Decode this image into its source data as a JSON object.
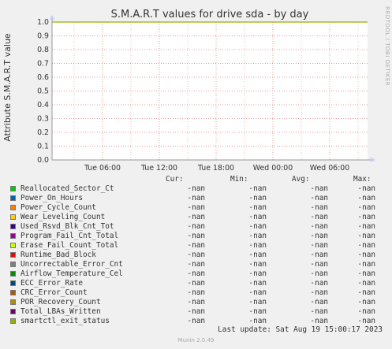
{
  "title": "S.M.A.R.T values for drive sda - by day",
  "watermark": "RRDTOOL / TOBI OETIKER",
  "chart_data": {
    "type": "line",
    "ylabel": "Attribute S.M.A.R.T value",
    "ylim": [
      0.0,
      1.0
    ],
    "yticks": [
      "0.0",
      "0.1",
      "0.2",
      "0.3",
      "0.4",
      "0.5",
      "0.6",
      "0.7",
      "0.8",
      "0.9",
      "1.0"
    ],
    "xticks": [
      "Tue 06:00",
      "Tue 12:00",
      "Tue 18:00",
      "Wed 00:00",
      "Wed 06:00"
    ],
    "grid": true,
    "series": [
      {
        "name": "Reallocated_Sector_Ct",
        "color": "#00cc00",
        "cur": "-nan",
        "min": "-nan",
        "avg": "-nan",
        "max": "-nan"
      },
      {
        "name": "Power_On_Hours",
        "color": "#0066b3",
        "cur": "-nan",
        "min": "-nan",
        "avg": "-nan",
        "max": "-nan"
      },
      {
        "name": "Power_Cycle_Count",
        "color": "#ff8000",
        "cur": "-nan",
        "min": "-nan",
        "avg": "-nan",
        "max": "-nan"
      },
      {
        "name": "Wear_Leveling_Count",
        "color": "#ffcc00",
        "cur": "-nan",
        "min": "-nan",
        "avg": "-nan",
        "max": "-nan"
      },
      {
        "name": "Used_Rsvd_Blk_Cnt_Tot",
        "color": "#330099",
        "cur": "-nan",
        "min": "-nan",
        "avg": "-nan",
        "max": "-nan"
      },
      {
        "name": "Program_Fail_Cnt_Total",
        "color": "#990099",
        "cur": "-nan",
        "min": "-nan",
        "avg": "-nan",
        "max": "-nan"
      },
      {
        "name": "Erase_Fail_Count_Total",
        "color": "#ccff00",
        "cur": "-nan",
        "min": "-nan",
        "avg": "-nan",
        "max": "-nan"
      },
      {
        "name": "Runtime_Bad_Block",
        "color": "#ff0000",
        "cur": "-nan",
        "min": "-nan",
        "avg": "-nan",
        "max": "-nan"
      },
      {
        "name": "Uncorrectable_Error_Cnt",
        "color": "#808080",
        "cur": "-nan",
        "min": "-nan",
        "avg": "-nan",
        "max": "-nan"
      },
      {
        "name": "Airflow_Temperature_Cel",
        "color": "#008f00",
        "cur": "-nan",
        "min": "-nan",
        "avg": "-nan",
        "max": "-nan"
      },
      {
        "name": "ECC_Error_Rate",
        "color": "#00487d",
        "cur": "-nan",
        "min": "-nan",
        "avg": "-nan",
        "max": "-nan"
      },
      {
        "name": "CRC_Error_Count",
        "color": "#b35a00",
        "cur": "-nan",
        "min": "-nan",
        "avg": "-nan",
        "max": "-nan"
      },
      {
        "name": "POR_Recovery_Count",
        "color": "#b38f00",
        "cur": "-nan",
        "min": "-nan",
        "avg": "-nan",
        "max": "-nan"
      },
      {
        "name": "Total_LBAs_Written",
        "color": "#6b006b",
        "cur": "-nan",
        "min": "-nan",
        "avg": "-nan",
        "max": "-nan"
      },
      {
        "name": "smartctl_exit_status",
        "color": "#8fb300",
        "cur": "-nan",
        "min": "-nan",
        "avg": "-nan",
        "max": "-nan"
      }
    ],
    "reference_line": {
      "value": 1.0,
      "color": "#8fb300"
    }
  },
  "legend_headers": {
    "cur": "Cur:",
    "min": "Min:",
    "avg": "Avg:",
    "max": "Max:"
  },
  "footer": "Last update: Sat Aug 19 15:00:17 2023",
  "munin_version": "Munin 2.0.49"
}
